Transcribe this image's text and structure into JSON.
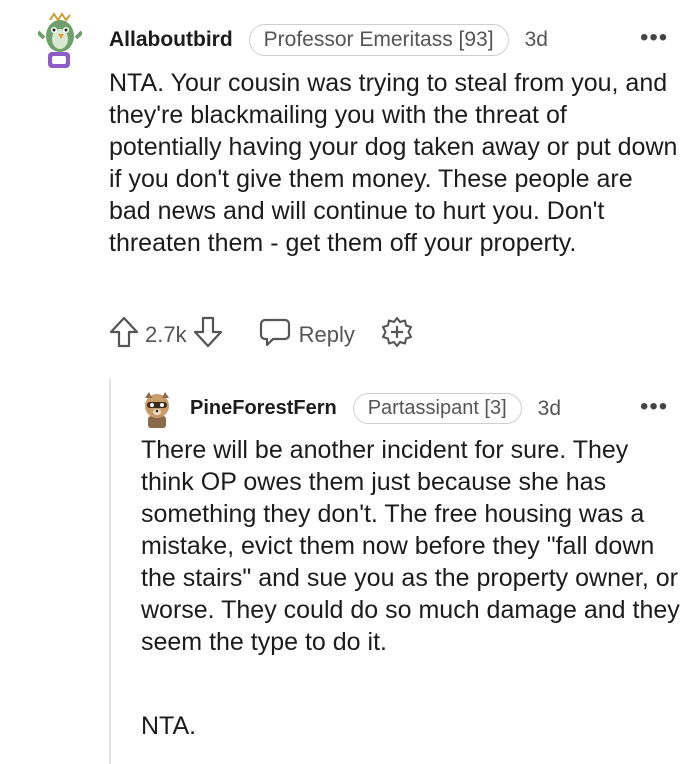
{
  "comments": [
    {
      "username": "Allaboutbird",
      "flair": "Professor Emeritass [93]",
      "age": "3d",
      "more": "•••",
      "body": "NTA. Your cousin was trying to steal from you, and they're blackmailing you with the threat of potentially having your dog taken away or put down if you don't give them money. These people are bad news and will continue to hurt you. Don't threaten them - get them off your property.",
      "votes": "2.7k",
      "reply_label": "Reply",
      "avatar_icon": "bird-avatar-icon"
    },
    {
      "username": "PineForestFern",
      "flair": "Partassipant [3]",
      "age": "3d",
      "more": "•••",
      "body": "There will be another incident for sure. They think OP owes them just because she has something they don't. The free housing was a mistake, evict them now before they \"fall down the stairs\" and sue you as the property owner, or worse. They could do so much damage and they seem the type to do it.",
      "body2": "NTA.",
      "avatar_icon": "raccoon-avatar-icon"
    }
  ],
  "colors": {
    "text": "#1c1c1c",
    "meta": "#555555",
    "flair_border": "#cfcfcf",
    "thread_line": "#e4e4e4"
  },
  "icons": [
    "upvote-icon",
    "downvote-icon",
    "reply-bubble-icon",
    "award-plus-icon",
    "more-options-icon"
  ]
}
